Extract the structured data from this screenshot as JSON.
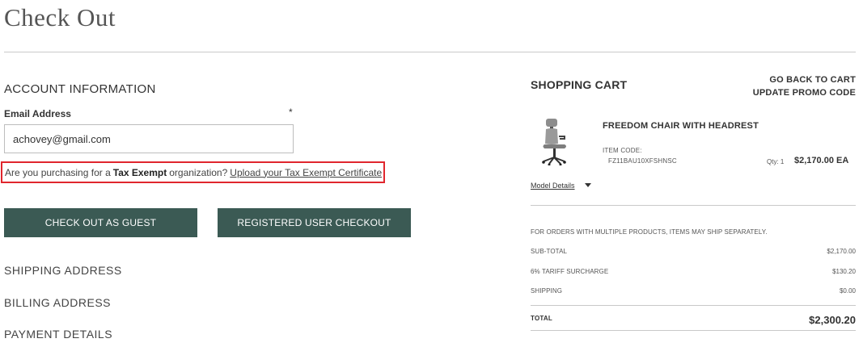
{
  "page": {
    "title": "Check Out"
  },
  "account": {
    "heading": "ACCOUNT INFORMATION",
    "email_label": "Email Address",
    "required_marker": "*",
    "email_value": "achovey@gmail.com",
    "tax_prefix": "Are you purchasing for a",
    "tax_bold": "Tax Exempt",
    "tax_suffix": "organization?",
    "tax_link": "Upload your Tax Exempt Certificate"
  },
  "buttons": {
    "guest": "CHECK OUT AS GUEST",
    "registered": "REGISTERED USER CHECKOUT"
  },
  "steps": {
    "shipping": "SHIPPING ADDRESS",
    "billing": "BILLING ADDRESS",
    "payment": "PAYMENT DETAILS"
  },
  "cart": {
    "heading": "SHOPPING CART",
    "back_link": "GO BACK TO CART",
    "promo_link": "UPDATE PROMO CODE",
    "item": {
      "image_icon": "office-chair-icon",
      "name": "FREEDOM CHAIR WITH HEADREST",
      "code_label": "ITEM CODE:",
      "code": "FZ11BAU10XFSHNSC",
      "qty": "Qty: 1",
      "price": "$2,170.00 EA",
      "details_link": "Model Details"
    },
    "notice": "FOR ORDERS WITH MULTIPLE PRODUCTS, ITEMS MAY SHIP SEPARATELY.",
    "subtotal_label": "SUB-TOTAL",
    "subtotal": "$2,170.00",
    "tariff_label": "6% TARIFF SURCHARGE",
    "tariff": "$130.20",
    "shipping_label": "SHIPPING",
    "shipping": "$0.00",
    "total_label": "TOTAL",
    "total": "$2,300.20"
  },
  "colors": {
    "button_bg": "#3b5a54",
    "highlight_border": "#e0262d"
  }
}
